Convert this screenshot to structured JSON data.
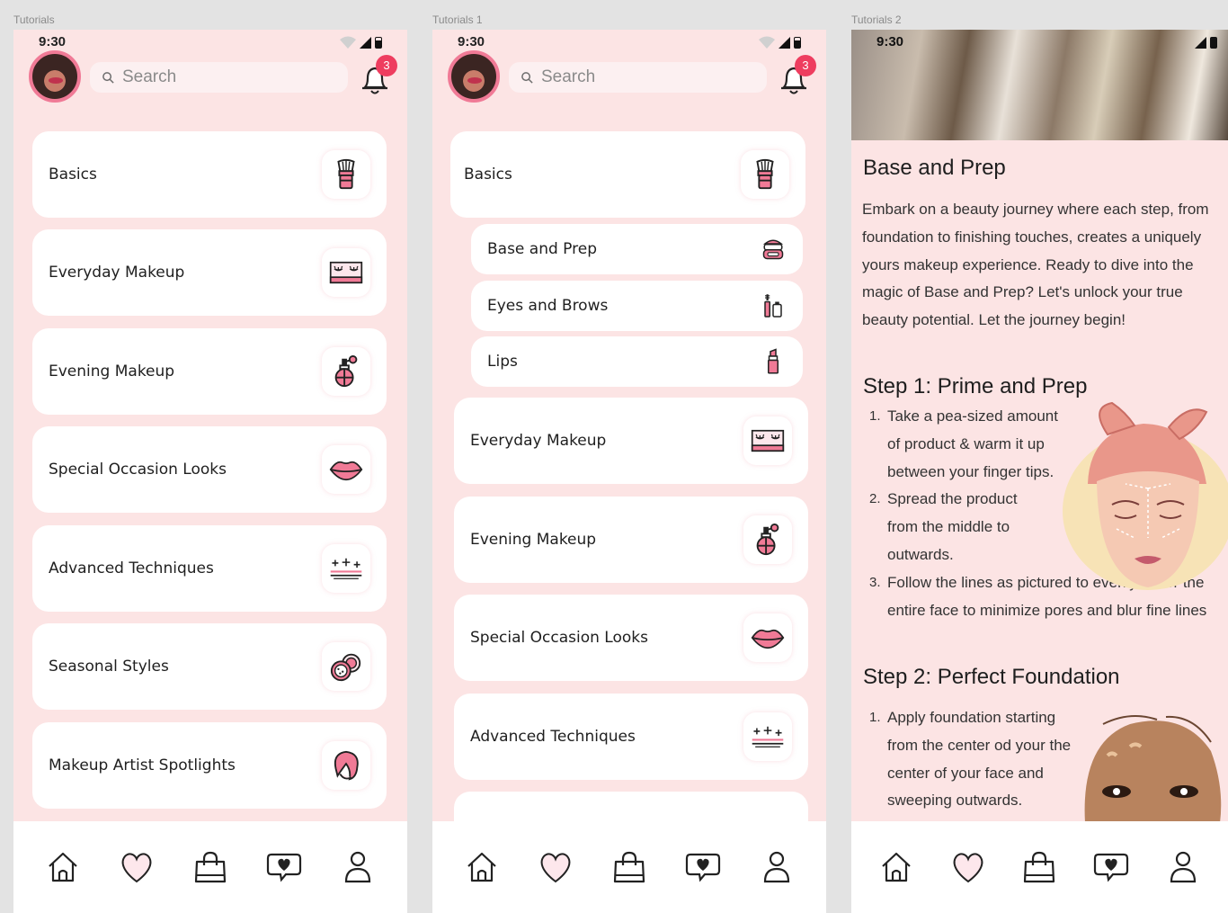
{
  "frames": {
    "f1": "Tutorials",
    "f2": "Tutorials 1",
    "f3": "Tutorials 2"
  },
  "status": {
    "time": "9:30"
  },
  "header": {
    "search_placeholder": "Search",
    "notifications_count": "3"
  },
  "screen1": {
    "items": [
      {
        "label": "Basics",
        "icon": "brush-icon"
      },
      {
        "label": "Everyday Makeup",
        "icon": "lashes-icon"
      },
      {
        "label": "Evening Makeup",
        "icon": "perfume-icon"
      },
      {
        "label": "Special Occasion Looks",
        "icon": "lips-icon"
      },
      {
        "label": "Advanced Techniques",
        "icon": "sparkles-icon"
      },
      {
        "label": "Seasonal Styles",
        "icon": "eyeshadow-icon"
      },
      {
        "label": "Makeup Artist Spotlights",
        "icon": "artist-icon"
      }
    ]
  },
  "screen2": {
    "basics": {
      "label": "Basics",
      "icon": "brush-icon"
    },
    "subitems": [
      {
        "label": "Base and Prep",
        "icon": "compact-icon"
      },
      {
        "label": "Eyes and Brows",
        "icon": "mascara-icon"
      },
      {
        "label": "Lips",
        "icon": "lipstick-icon"
      }
    ],
    "items": [
      {
        "label": "Everyday Makeup",
        "icon": "lashes-icon"
      },
      {
        "label": "Evening Makeup",
        "icon": "perfume-icon"
      },
      {
        "label": "Special Occasion Looks",
        "icon": "lips-icon"
      },
      {
        "label": "Advanced Techniques",
        "icon": "sparkles-icon"
      }
    ]
  },
  "screen3": {
    "title": "Base and Prep",
    "intro": "Embark on a beauty journey where each step, from foundation to finishing touches, creates a uniquely yours makeup experience. Ready to dive into the magic of Base and Prep? Let's unlock your true beauty potential. Let the journey begin!",
    "step1": {
      "title": "Step 1: Prime and Prep",
      "items": [
        {
          "num": "1.",
          "text": "Take a pea-sized amount of product & warm it up between your finger tips."
        },
        {
          "num": "2.",
          "text": "Spread the product from the middle to outwards."
        },
        {
          "num": "3.",
          "text": "Follow the lines as pictured to evenly cover the entire face to minimize pores and blur fine lines"
        }
      ]
    },
    "step2": {
      "title": "Step 2: Perfect Foundation",
      "items": [
        {
          "num": "1.",
          "text": "Apply foundation starting from the center od your the center of your face and sweeping outwards."
        }
      ]
    }
  },
  "nav": [
    "home-icon",
    "heart-icon",
    "bag-icon",
    "chat-heart-icon",
    "profile-icon"
  ],
  "colors": {
    "accent": "#ee3d5f",
    "background": "#fce4e4",
    "icon_pink": "#f07a96"
  }
}
